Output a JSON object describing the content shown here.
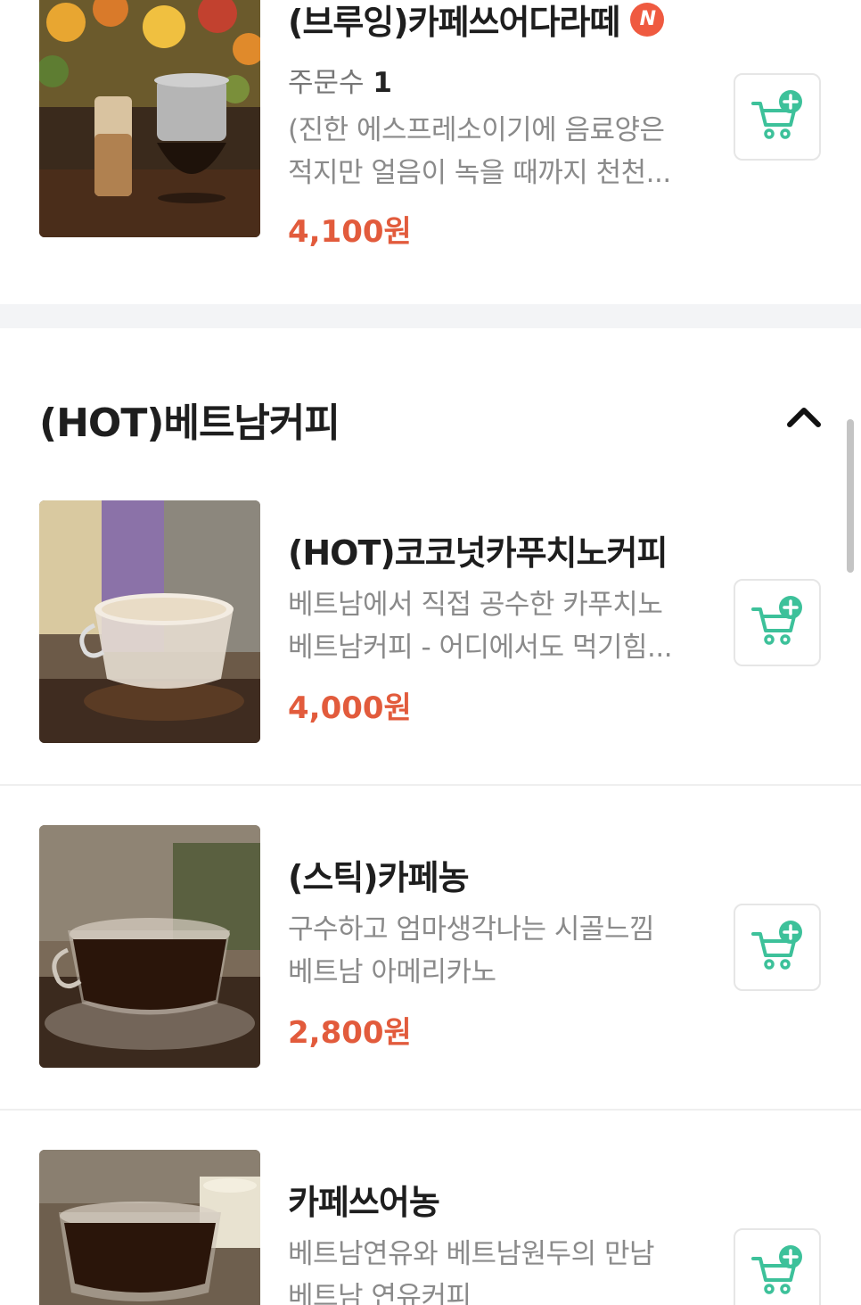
{
  "items_top": [
    {
      "title": "(브루잉)카페쓰어다라떼",
      "badge": "N",
      "orders_label": "주문수",
      "orders_count": "1",
      "desc_line1": "(진한 에스프레소이기에 음료양은",
      "desc_line2": "적지만 얼음이 녹을 때까지 천천...",
      "price": "4,100원"
    }
  ],
  "section": {
    "title": "(HOT)베트남커피",
    "toggle_icon": "chevron-up-icon"
  },
  "items": [
    {
      "title": "(HOT)코코넛카푸치노커피",
      "desc_line1": "베트남에서 직접 공수한 카푸치노",
      "desc_line2": "베트남커피 - 어디에서도 먹기힘...",
      "price": "4,000원"
    },
    {
      "title": "(스틱)카페농",
      "desc_line1": "구수하고 엄마생각나는 시골느낌",
      "desc_line2": "베트남 아메리카노",
      "price": "2,800원"
    },
    {
      "title": "카페쓰어농",
      "desc_line1": "베트남연유와 베트남원두의 만남",
      "desc_line2": "베트남 연유커피",
      "price": ""
    }
  ],
  "cart_icon": "cart-add-icon",
  "colors": {
    "price": "#e25b3c",
    "badge": "#ef5a40",
    "cart_accent": "#3dc19a"
  }
}
